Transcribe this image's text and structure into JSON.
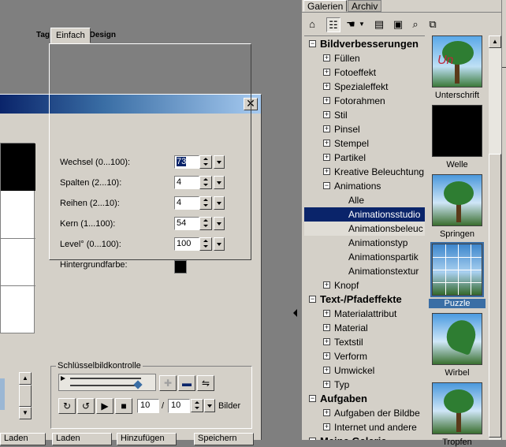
{
  "canvas": {
    "credit": "Tag by Petras Design"
  },
  "dialog": {
    "close_glyph": "✕",
    "tab": "Einfach",
    "params": [
      {
        "label": "Wechsel (0...100):",
        "value": "73"
      },
      {
        "label": "Spalten (2...10):",
        "value": "4"
      },
      {
        "label": "Reihen (2...10):",
        "value": "4"
      },
      {
        "label": "Kern (1...100):",
        "value": "54"
      },
      {
        "label": "Level° (0...100):",
        "value": "100"
      }
    ],
    "bg_label": "Hintergrundfarbe:",
    "bg_color": "#000000",
    "keyframe_group": "Schlüsselbildkontrolle",
    "frame_current": "10",
    "frame_sep": "/",
    "frame_total": "10",
    "frames_unit": "Bilder",
    "bottom_buttons": [
      "Laden",
      "Laden",
      "Hinzufügen",
      "Speichern"
    ]
  },
  "gallery": {
    "tabs": [
      "Galerien",
      "Archiv"
    ],
    "tools": [
      "home-icon",
      "tree-view-icon",
      "hand-icon",
      "menu-arrow-icon",
      "properties-icon",
      "image-edit-icon",
      "search-icon",
      "copy-icon"
    ],
    "tree": [
      {
        "label": "Bildverbesserungen",
        "level": 0,
        "expanded": true
      },
      {
        "label": "Füllen",
        "level": 1
      },
      {
        "label": "Fotoeffekt",
        "level": 1
      },
      {
        "label": "Spezialeffekt",
        "level": 1
      },
      {
        "label": "Fotorahmen",
        "level": 1
      },
      {
        "label": "Stil",
        "level": 1
      },
      {
        "label": "Pinsel",
        "level": 1
      },
      {
        "label": "Stempel",
        "level": 1
      },
      {
        "label": "Partikel",
        "level": 1
      },
      {
        "label": "Kreative Beleuchtung",
        "level": 1
      },
      {
        "label": "Animations",
        "level": 1,
        "expanded": true
      },
      {
        "label": "Alle",
        "level": 2
      },
      {
        "label": "Animationsstudio",
        "level": 2,
        "selected": true
      },
      {
        "label": "Animationsbeleuc",
        "level": 2
      },
      {
        "label": "Animationstyp",
        "level": 2
      },
      {
        "label": "Animationspartik",
        "level": 2
      },
      {
        "label": "Animationstextur",
        "level": 2
      },
      {
        "label": "Knopf",
        "level": 1
      },
      {
        "label": "Text-/Pfadeffekte",
        "level": 0,
        "expanded": true
      },
      {
        "label": "Materialattribut",
        "level": 1
      },
      {
        "label": "Material",
        "level": 1
      },
      {
        "label": "Textstil",
        "level": 1
      },
      {
        "label": "Verform",
        "level": 1
      },
      {
        "label": "Umwickel",
        "level": 1
      },
      {
        "label": "Typ",
        "level": 1
      },
      {
        "label": "Aufgaben",
        "level": 0,
        "expanded": true
      },
      {
        "label": "Aufgaben der Bildbe",
        "level": 1
      },
      {
        "label": "Internet und andere",
        "level": 1
      },
      {
        "label": "Meine Galerie",
        "level": 0,
        "expanded": true
      }
    ],
    "thumbnails": [
      "Unterschrift",
      "Welle",
      "Springen",
      "Puzzle",
      "Wirbel",
      "Tropfen"
    ],
    "selected_thumbnail": "Puzzle"
  }
}
